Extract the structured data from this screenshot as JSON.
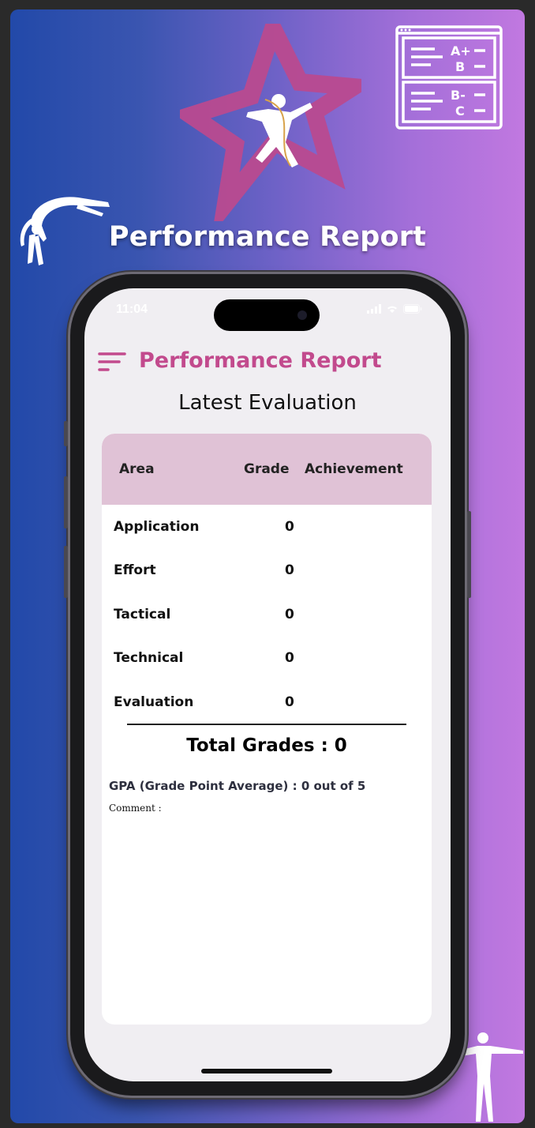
{
  "banner": {
    "title": "Performance Report",
    "grade_icon_letters": [
      "A+",
      "B",
      "B-",
      "C"
    ]
  },
  "status_bar": {
    "time": "11:04"
  },
  "app": {
    "title": "Performance Report",
    "section_title": "Latest Evaluation"
  },
  "table": {
    "headers": {
      "area": "Area",
      "grade": "Grade",
      "achievement": "Achievement"
    },
    "rows": [
      {
        "area": "Application",
        "grade": "0"
      },
      {
        "area": "Effort",
        "grade": "0"
      },
      {
        "area": "Tactical",
        "grade": "0"
      },
      {
        "area": "Technical",
        "grade": "0"
      },
      {
        "area": "Evaluation",
        "grade": "0"
      }
    ]
  },
  "summary": {
    "total": "Total Grades : 0",
    "gpa": "GPA (Grade Point Average) : 0 out of 5",
    "comment": "Comment :"
  },
  "colors": {
    "accent": "#c24a8d",
    "header_bg": "#e0c2d6",
    "gradient_start": "#2249a9",
    "gradient_end": "#c178e0"
  }
}
